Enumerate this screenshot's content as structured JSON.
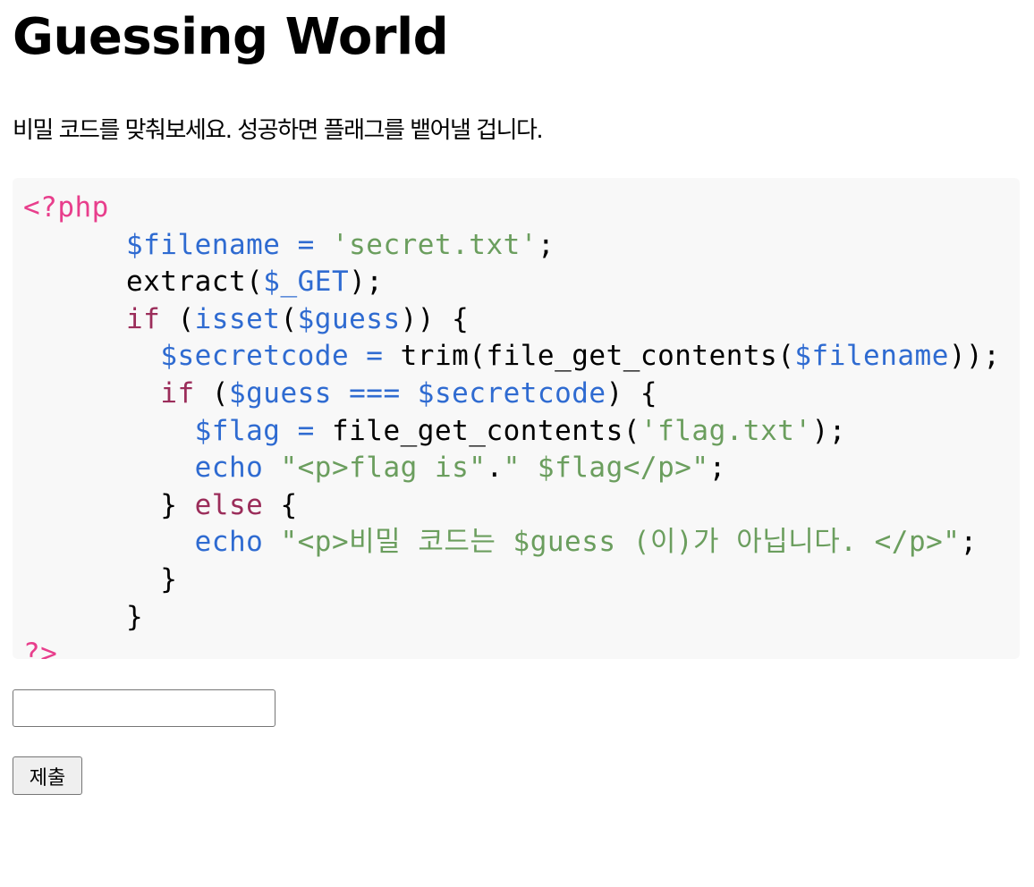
{
  "page": {
    "title": "Guessing World",
    "intro": "비밀 코드를 맞춰보세요. 성공하면 플래그를 뱉어낼 겁니다."
  },
  "code": {
    "lines": [
      [
        {
          "t": "<?php",
          "k": "delim"
        }
      ],
      [
        {
          "t": "      ",
          "k": "plain"
        },
        {
          "t": "$filename",
          "k": "var"
        },
        {
          "t": " = ",
          "k": "op"
        },
        {
          "t": "'secret.txt'",
          "k": "str"
        },
        {
          "t": ";",
          "k": "plain"
        }
      ],
      [
        {
          "t": "      extract(",
          "k": "plain"
        },
        {
          "t": "$_GET",
          "k": "var"
        },
        {
          "t": ");",
          "k": "plain"
        }
      ],
      [
        {
          "t": "      ",
          "k": "plain"
        },
        {
          "t": "if",
          "k": "kw"
        },
        {
          "t": " (",
          "k": "plain"
        },
        {
          "t": "isset",
          "k": "fn"
        },
        {
          "t": "(",
          "k": "plain"
        },
        {
          "t": "$guess",
          "k": "var"
        },
        {
          "t": ")) {",
          "k": "plain"
        }
      ],
      [
        {
          "t": "        ",
          "k": "plain"
        },
        {
          "t": "$secretcode",
          "k": "var"
        },
        {
          "t": " = ",
          "k": "op"
        },
        {
          "t": "trim(file_get_contents(",
          "k": "plain"
        },
        {
          "t": "$filename",
          "k": "var"
        },
        {
          "t": "));",
          "k": "plain"
        }
      ],
      [
        {
          "t": "        ",
          "k": "plain"
        },
        {
          "t": "if",
          "k": "kw"
        },
        {
          "t": " (",
          "k": "plain"
        },
        {
          "t": "$guess",
          "k": "var"
        },
        {
          "t": " === ",
          "k": "op"
        },
        {
          "t": "$secretcode",
          "k": "var"
        },
        {
          "t": ") {",
          "k": "plain"
        }
      ],
      [
        {
          "t": "          ",
          "k": "plain"
        },
        {
          "t": "$flag",
          "k": "var"
        },
        {
          "t": " = ",
          "k": "op"
        },
        {
          "t": "file_get_contents(",
          "k": "plain"
        },
        {
          "t": "'flag.txt'",
          "k": "str"
        },
        {
          "t": ");",
          "k": "plain"
        }
      ],
      [
        {
          "t": "          ",
          "k": "plain"
        },
        {
          "t": "echo",
          "k": "fn"
        },
        {
          "t": " ",
          "k": "plain"
        },
        {
          "t": "\"<p>flag is\"",
          "k": "str"
        },
        {
          "t": ".",
          "k": "plain"
        },
        {
          "t": "\" $flag</p>\"",
          "k": "str"
        },
        {
          "t": ";",
          "k": "plain"
        }
      ],
      [
        {
          "t": "        } ",
          "k": "plain"
        },
        {
          "t": "else",
          "k": "kw"
        },
        {
          "t": " {",
          "k": "plain"
        }
      ],
      [
        {
          "t": "          ",
          "k": "plain"
        },
        {
          "t": "echo",
          "k": "fn"
        },
        {
          "t": " ",
          "k": "plain"
        },
        {
          "t": "\"<p>비밀 코드는 $guess (이)가 아닙니다. </p>\"",
          "k": "str"
        },
        {
          "t": ";",
          "k": "plain"
        }
      ],
      [
        {
          "t": "        }",
          "k": "plain"
        }
      ],
      [
        {
          "t": "      }",
          "k": "plain"
        }
      ],
      [
        {
          "t": "?>",
          "k": "delim"
        }
      ]
    ]
  },
  "form": {
    "guess_value": "",
    "guess_placeholder": "",
    "submit_label": "제출"
  },
  "colors": {
    "code_background": "#f8f8f8",
    "php_delimiter": "#e83e8c",
    "variable": "#2f6bd1",
    "string": "#6b9e5e",
    "keyword": "#9b2d5a"
  }
}
